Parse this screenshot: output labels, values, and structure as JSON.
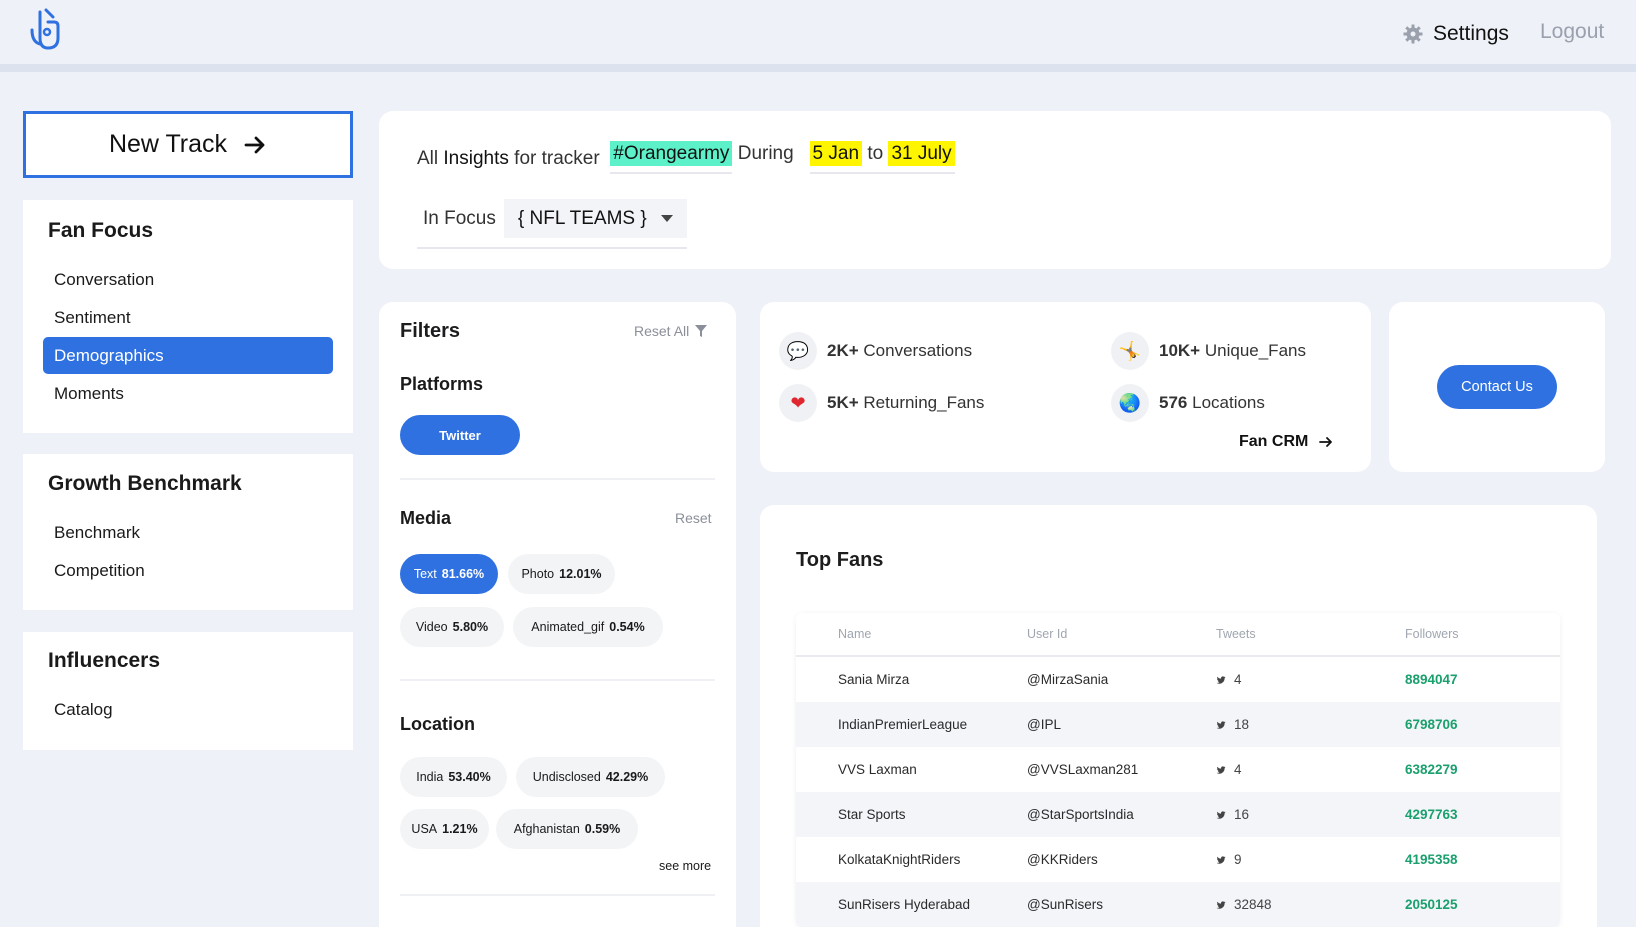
{
  "header": {
    "settings_label": "Settings",
    "logout_label": "Logout"
  },
  "sidebar": {
    "new_track_label": "New Track",
    "sections": [
      {
        "title": "Fan Focus",
        "items": [
          "Conversation",
          "Sentiment",
          "Demographics",
          "Moments"
        ],
        "active": "Demographics"
      },
      {
        "title": "Growth Benchmark",
        "items": [
          "Benchmark",
          "Competition"
        ]
      },
      {
        "title": "Influencers",
        "items": [
          "Catalog"
        ]
      }
    ]
  },
  "tracker": {
    "prefix": "All",
    "insights": "Insights",
    "for_tracker": "for tracker",
    "hashtag": "#Orangearmy",
    "during": "During",
    "start": "5 Jan",
    "to": "to",
    "end": "31 July",
    "in_focus_label": "In Focus",
    "focus_value": "{ NFL TEAMS }"
  },
  "filters": {
    "title": "Filters",
    "reset_all": "Reset All",
    "platforms_title": "Platforms",
    "platform": "Twitter",
    "media_title": "Media",
    "media_reset": "Reset",
    "media": [
      {
        "label": "Text",
        "pct": "81.66%",
        "selected": true
      },
      {
        "label": "Photo",
        "pct": "12.01%",
        "selected": false
      },
      {
        "label": "Video",
        "pct": "5.80%",
        "selected": false
      },
      {
        "label": "Animated_gif",
        "pct": "0.54%",
        "selected": false
      }
    ],
    "location_title": "Location",
    "locations": [
      {
        "label": "India",
        "pct": "53.40%"
      },
      {
        "label": "Undisclosed",
        "pct": "42.29%"
      },
      {
        "label": "USA",
        "pct": "1.21%"
      },
      {
        "label": "Afghanistan",
        "pct": "0.59%"
      }
    ],
    "see_more": "see more"
  },
  "stats": {
    "conversations": {
      "num": "2K+",
      "label": "Conversations",
      "icon": "speech-bubble-icon"
    },
    "unique_fans": {
      "num": "10K+",
      "label": "Unique_Fans",
      "icon": "dancer-icon"
    },
    "returning_fans": {
      "num": "5K+",
      "label": "Returning_Fans",
      "icon": "heart-icon"
    },
    "locations": {
      "num": "576",
      "label": "Locations",
      "icon": "globe-icon"
    },
    "fan_crm": "Fan CRM"
  },
  "contact": {
    "label": "Contact Us"
  },
  "top_fans": {
    "title": "Top Fans",
    "columns": [
      "Name",
      "User Id",
      "Tweets",
      "Followers"
    ],
    "rows": [
      {
        "name": "Sania Mirza",
        "user": "@MirzaSania",
        "tweets": "4",
        "followers": "8894047"
      },
      {
        "name": "IndianPremierLeague",
        "user": "@IPL",
        "tweets": "18",
        "followers": "6798706"
      },
      {
        "name": "VVS Laxman",
        "user": "@VVSLaxman281",
        "tweets": "4",
        "followers": "6382279"
      },
      {
        "name": "Star Sports",
        "user": "@StarSportsIndia",
        "tweets": "16",
        "followers": "4297763"
      },
      {
        "name": "KolkataKnightRiders",
        "user": "@KKRiders",
        "tweets": "9",
        "followers": "4195358"
      },
      {
        "name": "SunRisers Hyderabad",
        "user": "@SunRisers",
        "tweets": "32848",
        "followers": "2050125"
      }
    ]
  },
  "colors": {
    "accent": "#2f71e0",
    "highlight_green": "#5cf1c9",
    "highlight_yellow": "#fff500",
    "followers_green": "#1aa06d"
  }
}
